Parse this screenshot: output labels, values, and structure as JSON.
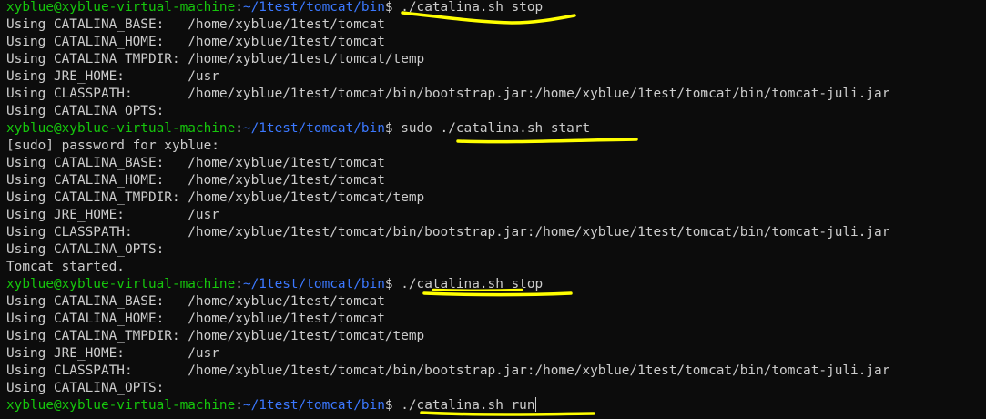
{
  "terminal": {
    "prompt": {
      "user_host": "xyblue@xyblue-virtual-machine",
      "colon": ":",
      "path": "~/1test/tomcat/bin",
      "dollar": "$"
    },
    "lines": [
      {
        "type": "prompt",
        "command": " ./catalina.sh stop"
      },
      {
        "type": "output",
        "text": "Using CATALINA_BASE:   /home/xyblue/1test/tomcat"
      },
      {
        "type": "output",
        "text": "Using CATALINA_HOME:   /home/xyblue/1test/tomcat"
      },
      {
        "type": "output",
        "text": "Using CATALINA_TMPDIR: /home/xyblue/1test/tomcat/temp"
      },
      {
        "type": "output",
        "text": "Using JRE_HOME:        /usr"
      },
      {
        "type": "output",
        "text": "Using CLASSPATH:       /home/xyblue/1test/tomcat/bin/bootstrap.jar:/home/xyblue/1test/tomcat/bin/tomcat-juli.jar"
      },
      {
        "type": "output",
        "text": "Using CATALINA_OPTS:"
      },
      {
        "type": "prompt",
        "command": " sudo ./catalina.sh start"
      },
      {
        "type": "output",
        "text": "[sudo] password for xyblue:"
      },
      {
        "type": "output",
        "text": "Using CATALINA_BASE:   /home/xyblue/1test/tomcat"
      },
      {
        "type": "output",
        "text": "Using CATALINA_HOME:   /home/xyblue/1test/tomcat"
      },
      {
        "type": "output",
        "text": "Using CATALINA_TMPDIR: /home/xyblue/1test/tomcat/temp"
      },
      {
        "type": "output",
        "text": "Using JRE_HOME:        /usr"
      },
      {
        "type": "output",
        "text": "Using CLASSPATH:       /home/xyblue/1test/tomcat/bin/bootstrap.jar:/home/xyblue/1test/tomcat/bin/tomcat-juli.jar"
      },
      {
        "type": "output",
        "text": "Using CATALINA_OPTS:"
      },
      {
        "type": "output",
        "text": "Tomcat started."
      },
      {
        "type": "prompt",
        "command": " ./catalina.sh stop"
      },
      {
        "type": "output",
        "text": "Using CATALINA_BASE:   /home/xyblue/1test/tomcat"
      },
      {
        "type": "output",
        "text": "Using CATALINA_HOME:   /home/xyblue/1test/tomcat"
      },
      {
        "type": "output",
        "text": "Using CATALINA_TMPDIR: /home/xyblue/1test/tomcat/temp"
      },
      {
        "type": "output",
        "text": "Using JRE_HOME:        /usr"
      },
      {
        "type": "output",
        "text": "Using CLASSPATH:       /home/xyblue/1test/tomcat/bin/bootstrap.jar:/home/xyblue/1test/tomcat/bin/tomcat-juli.jar"
      },
      {
        "type": "output",
        "text": "Using CATALINA_OPTS:"
      },
      {
        "type": "prompt",
        "command": " ./catalina.sh run",
        "cursor": true
      }
    ]
  },
  "colors": {
    "background": "#0c0c0c",
    "text": "#cccccc",
    "user_host": "#16c60c",
    "path": "#3b78ff",
    "highlight_underline": "#ffff00"
  }
}
